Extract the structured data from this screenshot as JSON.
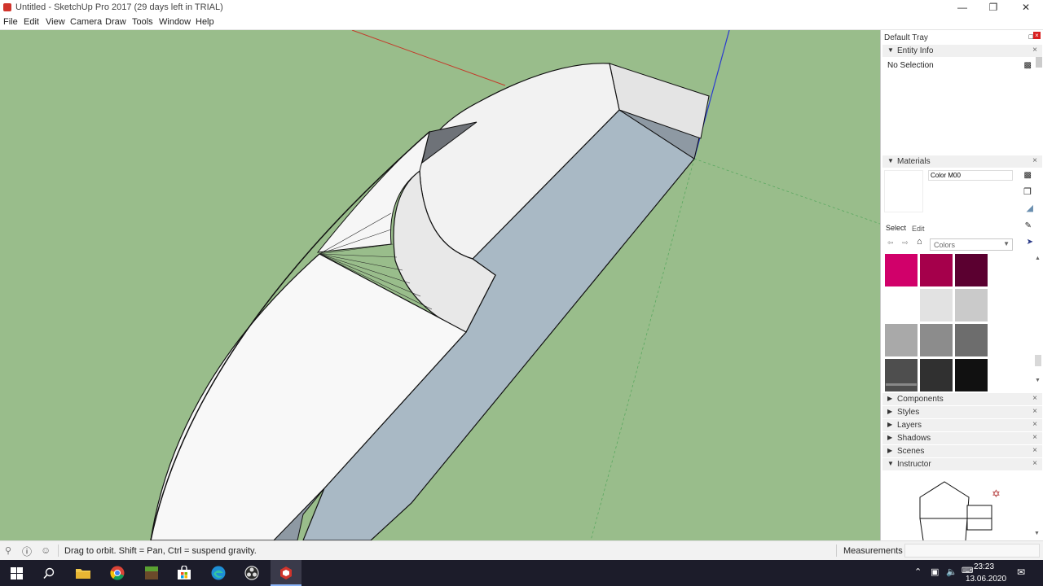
{
  "window": {
    "title": "Untitled - SketchUp Pro 2017 (29 days left in TRIAL)"
  },
  "menu": [
    "File",
    "Edit",
    "View",
    "Camera",
    "Draw",
    "Tools",
    "Window",
    "Help"
  ],
  "tray": {
    "title": "Default Tray",
    "entity_info": {
      "label": "Entity Info",
      "selection": "No Selection"
    },
    "materials": {
      "label": "Materials",
      "name_value": "Color M00",
      "select_tab": "Select",
      "edit_tab": "Edit",
      "collection": "Colors",
      "swatches": [
        "#d1006a",
        "#a5004b",
        "#5b0030",
        "#ffffff",
        "#e2e2e2",
        "#cacaca",
        "#a9a9a9",
        "#8c8c8c",
        "#6d6d6d",
        "#4e4e4e",
        "#303030",
        "#111111"
      ]
    },
    "collapsed_panels": [
      "Components",
      "Styles",
      "Layers",
      "Shadows",
      "Scenes"
    ],
    "instructor": {
      "label": "Instructor"
    }
  },
  "status": {
    "hint": "Drag to orbit. Shift = Pan, Ctrl = suspend gravity.",
    "measurements_label": "Measurements"
  },
  "taskbar": {
    "time": "23:23",
    "date": "13.06.2020"
  }
}
